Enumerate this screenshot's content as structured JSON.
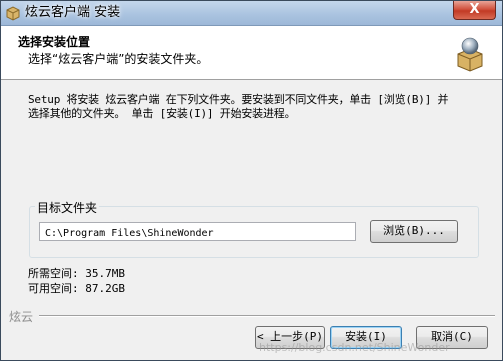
{
  "window": {
    "title": "炫云客户端 安装",
    "close_glyph": "X"
  },
  "header": {
    "title": "选择安装位置",
    "subtitle": "选择“炫云客户端”的安装文件夹。"
  },
  "description": {
    "line1": "Setup 将安装 炫云客户端 在下列文件夹。要安装到不同文件夹，单击 [浏览(B)] 并",
    "line2": "选择其他的文件夹。 单击 [安装(I)] 开始安装进程。"
  },
  "destination": {
    "group_label": "目标文件夹",
    "path_value": "C:\\Program Files\\ShineWonder",
    "browse_label": "浏览(B)..."
  },
  "space": {
    "required": "所需空间: 35.7MB",
    "available": "可用空间: 87.2GB"
  },
  "footer": {
    "brand": "炫云",
    "back_label": "< 上一步(P)",
    "install_label": "安装(I)",
    "cancel_label": "取消(C)"
  },
  "watermark": "https://blog.csdn.net/ShineWonder",
  "colors": {
    "titlebar": "#a9c2df",
    "close_button": "#c23a25",
    "dialog_bg": "#f0f0f0"
  }
}
